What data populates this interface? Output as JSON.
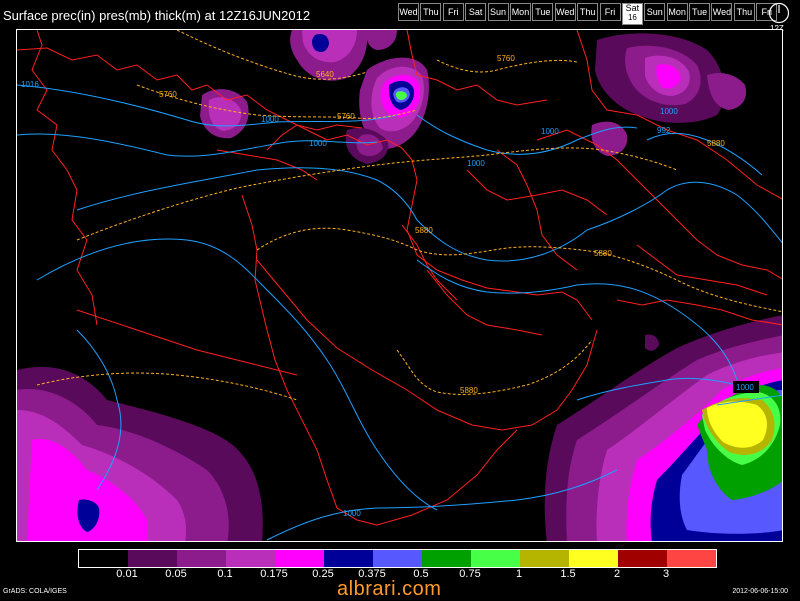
{
  "title": "Surface prec(in) pres(mb) thick(m) at 12Z16JUN2012",
  "day_buttons": [
    {
      "label": "Wed"
    },
    {
      "label": "Thu"
    },
    {
      "label": "Fri"
    },
    {
      "label": "Sat"
    },
    {
      "label": "Sun"
    },
    {
      "label": "Mon"
    },
    {
      "label": "Tue"
    },
    {
      "label": "Wed"
    },
    {
      "label": "Thu"
    },
    {
      "label": "Fri"
    },
    {
      "label": "Sat",
      "sub": "16",
      "selected": true
    },
    {
      "label": "Sun"
    },
    {
      "label": "Mon"
    },
    {
      "label": "Tue"
    },
    {
      "label": "Wed"
    },
    {
      "label": "Thu"
    },
    {
      "label": "Fri"
    }
  ],
  "clock_label": "12Z",
  "map": {
    "contour_labels": {
      "pressure": [
        "1016",
        "1000",
        "1000",
        "1000",
        "1000",
        "992",
        "1000",
        "1000",
        "1000"
      ],
      "thickness": [
        "5640",
        "5760",
        "5760",
        "5760",
        "5880",
        "5880",
        "5880",
        "5880"
      ]
    },
    "colors": {
      "coastline": "#ff2020",
      "pressure_contour": "#1fa0ff",
      "thickness_contour": "#ffb020"
    }
  },
  "legend": {
    "colors": [
      "#000000",
      "#5a0a5a",
      "#8c1c8c",
      "#b92fb9",
      "#ff00ff",
      "#000099",
      "#5858ff",
      "#00a000",
      "#46ff46",
      "#b5b500",
      "#ffff20",
      "#a00000",
      "#ff4444"
    ],
    "labels": [
      "0.01",
      "0.05",
      "0.1",
      "0.175",
      "0.25",
      "0.375",
      "0.5",
      "0.75",
      "1",
      "1.5",
      "2",
      "3"
    ]
  },
  "footer_left": "GrADS: COLA/IGES",
  "footer_right": "2012-06-06-15:00",
  "watermark": "albrari.com"
}
